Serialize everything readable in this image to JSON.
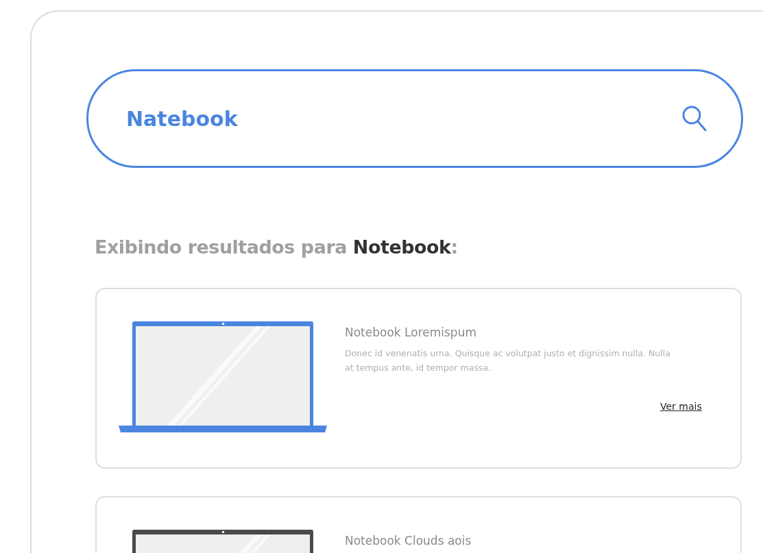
{
  "search": {
    "value": "Natebook"
  },
  "results_heading": "Exibindo resultados para **Notebook**:",
  "products": [
    {
      "title": "Notebook Loremispum",
      "description": "Donec id venenatis urna. Quisque ac volutpat justo et dignissim nulla. Nulla at tempus ante, id tempor massa.",
      "link": "Ver mais",
      "color": "#4a86e0"
    },
    {
      "title": "Notebook Clouds aois",
      "color": "#4a4a4a"
    }
  ]
}
